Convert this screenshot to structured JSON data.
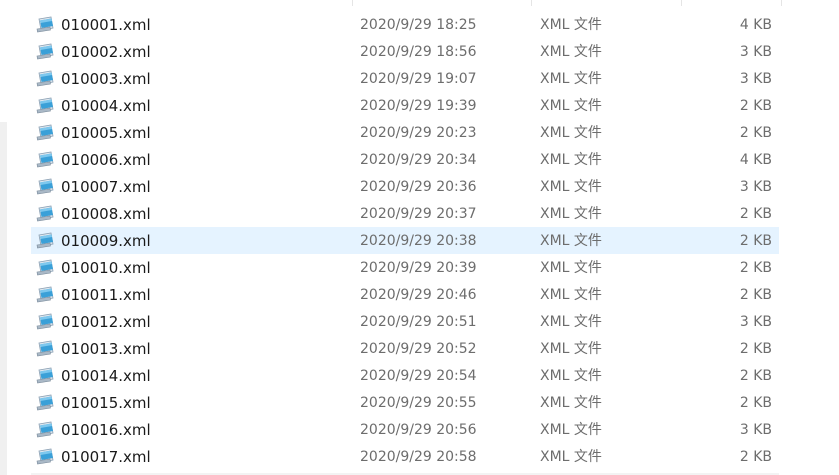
{
  "files": [
    {
      "name": "010001.xml",
      "modified": "2020/9/29 18:25",
      "type": "XML 文件",
      "size": "4 KB",
      "selected": false
    },
    {
      "name": "010002.xml",
      "modified": "2020/9/29 18:56",
      "type": "XML 文件",
      "size": "3 KB",
      "selected": false
    },
    {
      "name": "010003.xml",
      "modified": "2020/9/29 19:07",
      "type": "XML 文件",
      "size": "3 KB",
      "selected": false
    },
    {
      "name": "010004.xml",
      "modified": "2020/9/29 19:39",
      "type": "XML 文件",
      "size": "2 KB",
      "selected": false
    },
    {
      "name": "010005.xml",
      "modified": "2020/9/29 20:23",
      "type": "XML 文件",
      "size": "2 KB",
      "selected": false
    },
    {
      "name": "010006.xml",
      "modified": "2020/9/29 20:34",
      "type": "XML 文件",
      "size": "4 KB",
      "selected": false
    },
    {
      "name": "010007.xml",
      "modified": "2020/9/29 20:36",
      "type": "XML 文件",
      "size": "3 KB",
      "selected": false
    },
    {
      "name": "010008.xml",
      "modified": "2020/9/29 20:37",
      "type": "XML 文件",
      "size": "2 KB",
      "selected": false
    },
    {
      "name": "010009.xml",
      "modified": "2020/9/29 20:38",
      "type": "XML 文件",
      "size": "2 KB",
      "selected": true
    },
    {
      "name": "010010.xml",
      "modified": "2020/9/29 20:39",
      "type": "XML 文件",
      "size": "2 KB",
      "selected": false
    },
    {
      "name": "010011.xml",
      "modified": "2020/9/29 20:46",
      "type": "XML 文件",
      "size": "2 KB",
      "selected": false
    },
    {
      "name": "010012.xml",
      "modified": "2020/9/29 20:51",
      "type": "XML 文件",
      "size": "3 KB",
      "selected": false
    },
    {
      "name": "010013.xml",
      "modified": "2020/9/29 20:52",
      "type": "XML 文件",
      "size": "2 KB",
      "selected": false
    },
    {
      "name": "010014.xml",
      "modified": "2020/9/29 20:54",
      "type": "XML 文件",
      "size": "2 KB",
      "selected": false
    },
    {
      "name": "010015.xml",
      "modified": "2020/9/29 20:55",
      "type": "XML 文件",
      "size": "2 KB",
      "selected": false
    },
    {
      "name": "010016.xml",
      "modified": "2020/9/29 20:56",
      "type": "XML 文件",
      "size": "3 KB",
      "selected": false
    },
    {
      "name": "010017.xml",
      "modified": "2020/9/29 20:58",
      "type": "XML 文件",
      "size": "2 KB",
      "selected": false
    }
  ],
  "icon": "xml-file-icon",
  "colors": {
    "selected_row_bg": "#e5f3ff",
    "name_text": "#1a1a1a",
    "detail_text": "#6d6d6d"
  }
}
